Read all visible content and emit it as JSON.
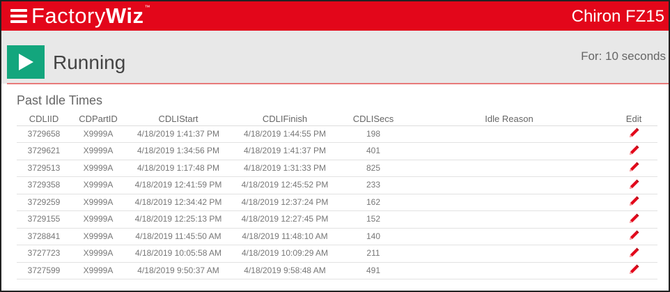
{
  "header": {
    "logo_light": "Factory",
    "logo_bold": "Wiz",
    "logo_tm": "™",
    "machine": "Chiron FZ15"
  },
  "status": {
    "icon": "play-icon",
    "state": "Running",
    "duration": "For: 10 seconds",
    "color": "#13a67d"
  },
  "section": {
    "title": "Past Idle Times"
  },
  "table": {
    "columns": [
      "CDLIID",
      "CDPartID",
      "CDLIStart",
      "CDLIFinish",
      "CDLISecs",
      "Idle Reason",
      "Edit"
    ],
    "rows": [
      [
        "3729658",
        "X9999A",
        "4/18/2019 1:41:37 PM",
        "4/18/2019 1:44:55 PM",
        "198",
        ""
      ],
      [
        "3729621",
        "X9999A",
        "4/18/2019 1:34:56 PM",
        "4/18/2019 1:41:37 PM",
        "401",
        ""
      ],
      [
        "3729513",
        "X9999A",
        "4/18/2019 1:17:48 PM",
        "4/18/2019 1:31:33 PM",
        "825",
        ""
      ],
      [
        "3729358",
        "X9999A",
        "4/18/2019 12:41:59 PM",
        "4/18/2019 12:45:52 PM",
        "233",
        ""
      ],
      [
        "3729259",
        "X9999A",
        "4/18/2019 12:34:42 PM",
        "4/18/2019 12:37:24 PM",
        "162",
        ""
      ],
      [
        "3729155",
        "X9999A",
        "4/18/2019 12:25:13 PM",
        "4/18/2019 12:27:45 PM",
        "152",
        ""
      ],
      [
        "3728841",
        "X9999A",
        "4/18/2019 11:45:50 AM",
        "4/18/2019 11:48:10 AM",
        "140",
        ""
      ],
      [
        "3727723",
        "X9999A",
        "4/18/2019 10:05:58 AM",
        "4/18/2019 10:09:29 AM",
        "211",
        ""
      ],
      [
        "3727599",
        "X9999A",
        "4/18/2019 9:50:37 AM",
        "4/18/2019 9:58:48 AM",
        "491",
        ""
      ]
    ],
    "edit_icon": "pencil-icon",
    "edit_color": "#e3061a"
  },
  "colors": {
    "brand": "#e3061a",
    "running": "#13a67d"
  }
}
